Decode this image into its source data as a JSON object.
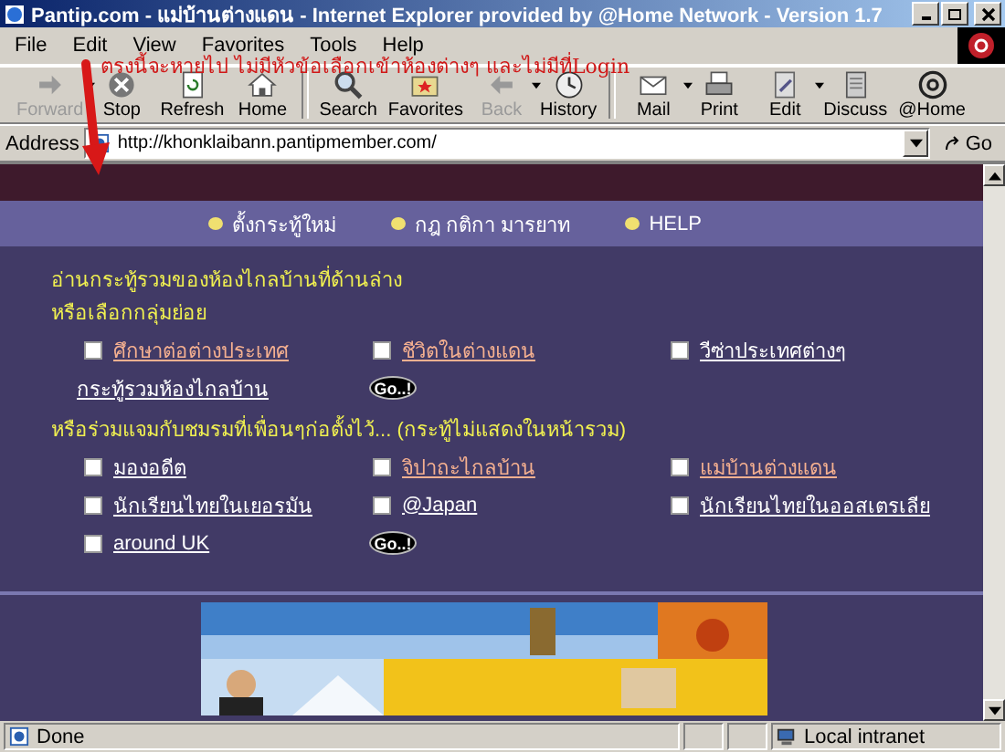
{
  "window": {
    "title": "Pantip.com - แม่บ้านต่างแดน - Internet Explorer provided by @Home Network - Version 1.7"
  },
  "menu": [
    "File",
    "Edit",
    "View",
    "Favorites",
    "Tools",
    "Help"
  ],
  "toolbar": [
    {
      "label": "Forward",
      "kind": "forward",
      "disabled": true,
      "dropdown": true
    },
    {
      "label": "Stop",
      "kind": "stop",
      "disabled": false,
      "dropdown": false
    },
    {
      "label": "Refresh",
      "kind": "refresh",
      "disabled": false,
      "dropdown": false
    },
    {
      "label": "Home",
      "kind": "home",
      "disabled": false,
      "dropdown": false
    },
    {
      "label": "Search",
      "kind": "search",
      "disabled": false,
      "dropdown": false,
      "sep": true
    },
    {
      "label": "Favorites",
      "kind": "favorites",
      "disabled": false,
      "dropdown": false
    },
    {
      "label": "Back",
      "kind": "back",
      "disabled": true,
      "dropdown": true
    },
    {
      "label": "History",
      "kind": "history",
      "disabled": false,
      "dropdown": false
    },
    {
      "label": "Mail",
      "kind": "mail",
      "disabled": false,
      "dropdown": true,
      "sep": true
    },
    {
      "label": "Print",
      "kind": "print",
      "disabled": false,
      "dropdown": false
    },
    {
      "label": "Edit",
      "kind": "edit",
      "disabled": false,
      "dropdown": true
    },
    {
      "label": "Discuss",
      "kind": "discuss",
      "disabled": false,
      "dropdown": false
    },
    {
      "label": "@Home",
      "kind": "at",
      "disabled": false,
      "dropdown": false
    }
  ],
  "address": {
    "label": "Address",
    "value": "http://khonklaibann.pantipmember.com/",
    "go": "Go"
  },
  "annotation": {
    "text": "ตรงนี้จะหายไป ไม่มีหัวข้อเลือกเข้าห้องต่างๆ และไม่มีที่Login"
  },
  "nav": [
    "ตั้งกระทู้ใหม่",
    "กฎ กติกา มารยาท",
    "HELP"
  ],
  "sections": [
    {
      "lines": [
        "อ่านกระทู้รวมของห้องไกลบ้านที่ด้านล่าง",
        "หรือเลือกกลุ่มย่อย"
      ],
      "items": [
        {
          "label": "ศึกษาต่อต่างประเทศ",
          "checked": false,
          "visited": true
        },
        {
          "label": "ชีวิตในต่างแดน",
          "checked": false,
          "visited": true
        },
        {
          "label": "วีซ่าประเทศต่างๆ",
          "checked": false,
          "visited": false
        }
      ],
      "extra_link": "กระทู้รวมห้องไกลบ้าน",
      "go": "Go..!"
    },
    {
      "lines": [
        "หรือร่วมแจมกับชมรมที่เพื่อนๆก่อตั้งไว้... (กระทู้ไม่แสดงในหน้ารวม)"
      ],
      "items": [
        {
          "label": "มองอดีต",
          "checked": false,
          "visited": false
        },
        {
          "label": "จิปาถะไกลบ้าน",
          "checked": false,
          "visited": true
        },
        {
          "label": "แม่บ้านต่างแดน",
          "checked": false,
          "visited": true
        },
        {
          "label": "นักเรียนไทยในเยอรมัน",
          "checked": false,
          "visited": false
        },
        {
          "label": "@Japan",
          "checked": false,
          "visited": false
        },
        {
          "label": "นักเรียนไทยในออสเตรเลีย",
          "checked": false,
          "visited": false
        },
        {
          "label": "around UK",
          "checked": false,
          "visited": false
        }
      ],
      "go": "Go..!"
    }
  ],
  "banner": {
    "kind": "picture"
  },
  "status_bar": {
    "text": "Done",
    "zone": "Local intranet"
  }
}
